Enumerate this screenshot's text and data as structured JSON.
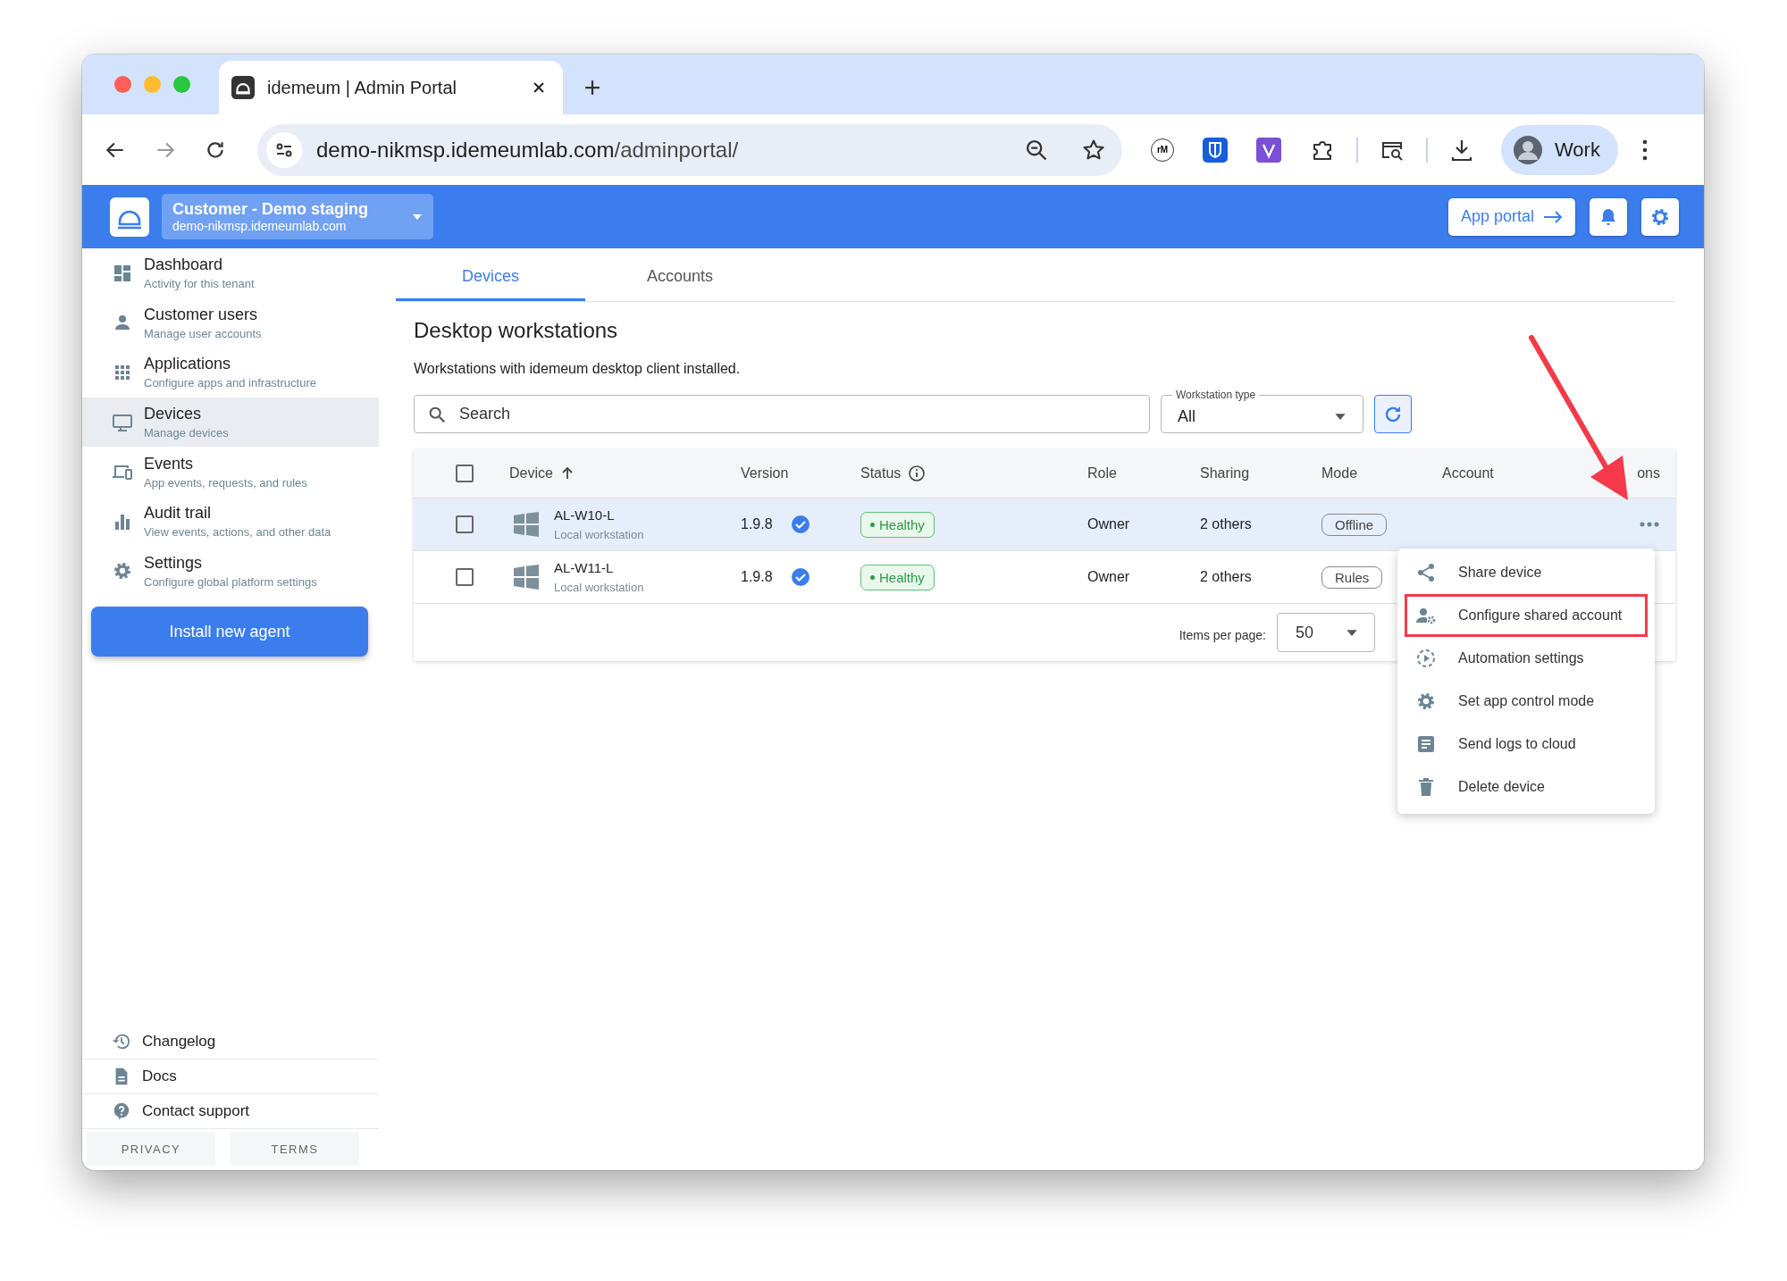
{
  "browser": {
    "tab_title": "idemeum | Admin Portal",
    "url_host": "demo-nikmsp.idemeumlab.com",
    "url_path": "/adminportal/",
    "extension_label": "rM",
    "profile": "Work"
  },
  "header": {
    "tenant_name": "Customer - Demo staging",
    "tenant_domain": "demo-nikmsp.idemeumlab.com",
    "app_portal": "App portal"
  },
  "sidebar": {
    "items": [
      {
        "title": "Dashboard",
        "subtitle": "Activity for this tenant",
        "selected": false
      },
      {
        "title": "Customer users",
        "subtitle": "Manage user accounts",
        "selected": false
      },
      {
        "title": "Applications",
        "subtitle": "Configure apps and infrastructure",
        "selected": false
      },
      {
        "title": "Devices",
        "subtitle": "Manage devices",
        "selected": true
      },
      {
        "title": "Events",
        "subtitle": "App events, requests, and rules",
        "selected": false
      },
      {
        "title": "Audit trail",
        "subtitle": "View events, actions, and other data",
        "selected": false
      },
      {
        "title": "Settings",
        "subtitle": "Configure global platform settings",
        "selected": false
      }
    ],
    "install_button": "Install new agent",
    "footer_links": [
      "Changelog",
      "Docs",
      "Contact support"
    ],
    "legal": [
      "PRIVACY",
      "TERMS"
    ]
  },
  "tabs": [
    {
      "label": "Devices",
      "selected": true
    },
    {
      "label": "Accounts",
      "selected": false
    }
  ],
  "section": {
    "title": "Desktop workstations",
    "description": "Workstations with idemeum desktop client installed."
  },
  "search": {
    "placeholder": "Search"
  },
  "workstation_type": {
    "label": "Workstation type",
    "value": "All"
  },
  "table": {
    "columns": [
      "Device",
      "Version",
      "Status",
      "Role",
      "Sharing",
      "Mode",
      "Account",
      "ons"
    ],
    "select_all_checked": false,
    "rows": [
      {
        "checked": false,
        "selected": true,
        "device": "AL-W10-L",
        "device_type": "Local workstation",
        "version": "1.9.8",
        "status": "Healthy",
        "role": "Owner",
        "sharing": "2 others",
        "mode": "Offline"
      },
      {
        "checked": false,
        "selected": false,
        "device": "AL-W11-L",
        "device_type": "Local workstation",
        "version": "1.9.8",
        "status": "Healthy",
        "role": "Owner",
        "sharing": "2 others",
        "mode": "Rules"
      }
    ]
  },
  "pagination": {
    "label": "Items per page:",
    "value": "50"
  },
  "menu": {
    "items": [
      {
        "label": "Share device",
        "highlighted": false
      },
      {
        "label": "Configure shared account",
        "highlighted": true
      },
      {
        "label": "Automation settings",
        "highlighted": false
      },
      {
        "label": "Set app control mode",
        "highlighted": false
      },
      {
        "label": "Send logs to cloud",
        "highlighted": false
      },
      {
        "label": "Delete device",
        "highlighted": false
      }
    ]
  }
}
